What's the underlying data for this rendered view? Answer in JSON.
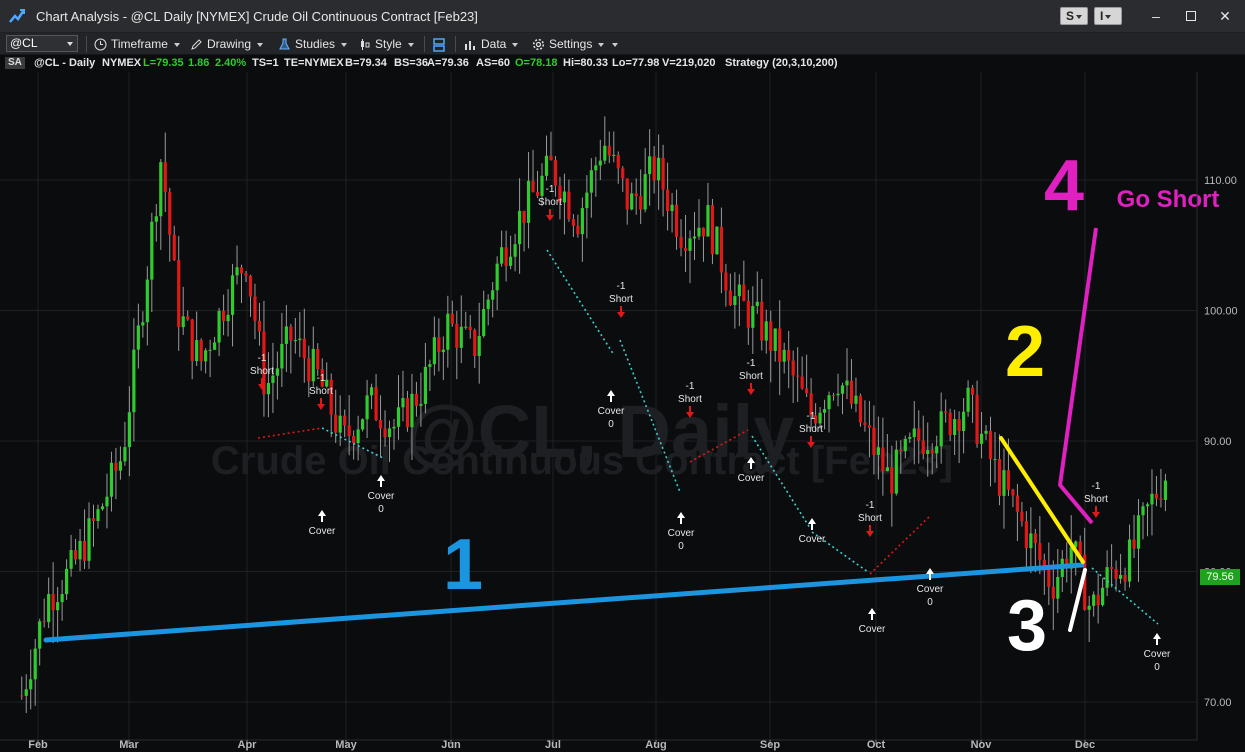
{
  "window": {
    "title": "Chart Analysis - @CL Daily [NYMEX] Crude Oil Continuous Contract [Feb23]",
    "btn_s": "S",
    "btn_i": "I"
  },
  "toolbar": {
    "symbol": "@CL",
    "timeframe": "Timeframe",
    "drawing": "Drawing",
    "studies": "Studies",
    "style": "Style",
    "data": "Data",
    "settings": "Settings"
  },
  "status": {
    "badge": "SA",
    "symbol": "@CL - Daily",
    "exchange": "NYMEX",
    "last": "L=79.35",
    "change": "1.86",
    "change_pct": "2.40%",
    "ts": "TS=1",
    "te": "TE=NYMEX",
    "bid": "B=79.34",
    "bid_size": "BS=36",
    "ask": "A=79.36",
    "ask_size": "AS=60",
    "open": "O=78.18",
    "high": "Hi=80.33",
    "low": "Lo=77.98",
    "volume": "V=219,020",
    "strategy": "Strategy (20,3,10,200)"
  },
  "colors": {
    "up": "#2ecc2e",
    "down": "#e01818",
    "line1": "#1c95e0",
    "line2": "#ffee00",
    "line3": "#ffffff",
    "line4": "#e020c0",
    "grid": "#1f2124",
    "trade": "#3ad0d0"
  },
  "watermark": {
    "line1": "@CL, Daily",
    "line2": "Crude Oil Continuous Contract [Feb23]"
  },
  "price_tag": "79.56",
  "chart_data": {
    "type": "candlestick",
    "x_labels": [
      "Feb",
      "Mar",
      "Apr",
      "May",
      "Jun",
      "Jul",
      "Aug",
      "Sep",
      "Oct",
      "Nov",
      "Dec"
    ],
    "y_ticks": [
      "110.00",
      "100.00",
      "90.00",
      "80.00",
      "70.00"
    ],
    "ylim": [
      69,
      114
    ],
    "last_price": 79.56,
    "trendlines": [
      {
        "label": "1",
        "from": [
          "Feb",
          74.8
        ],
        "to": [
          "Dec",
          80.6
        ]
      },
      {
        "label": "2",
        "from": [
          "Nov",
          92.0
        ],
        "to": [
          "Dec",
          80.6
        ]
      },
      {
        "label": "3",
        "from": [
          "Nov",
          76.0
        ],
        "to": [
          "Dec",
          80.6
        ]
      },
      {
        "label": "4",
        "from": [
          "Nov",
          86.5
        ],
        "to": [
          "Dec",
          106.0
        ]
      }
    ],
    "annotations": [
      {
        "text": "1",
        "color": "#1c95e0"
      },
      {
        "text": "2",
        "color": "#ffee00"
      },
      {
        "text": "3",
        "color": "#ffffff"
      },
      {
        "text": "4",
        "color": "#e020c0"
      },
      {
        "text": "Go Short",
        "color": "#e020c0"
      }
    ],
    "signals": [
      {
        "kind": "short",
        "label": "Short",
        "qty": "-1",
        "month": "Apr",
        "price": 94.0
      },
      {
        "kind": "short",
        "label": "Short",
        "qty": "-1",
        "month": "Apr",
        "price": 92.0
      },
      {
        "kind": "cover",
        "label": "Cover",
        "qty": "",
        "month": "Apr",
        "price": 85.5
      },
      {
        "kind": "cover",
        "label": "Cover",
        "qty": "0",
        "month": "May",
        "price": 88.3
      },
      {
        "kind": "short",
        "label": "Short",
        "qty": "-1",
        "month": "Jul",
        "price": 105.0
      },
      {
        "kind": "short",
        "label": "Short",
        "qty": "-1",
        "month": "Jul",
        "price": 97.5
      },
      {
        "kind": "cover",
        "label": "Cover",
        "qty": "0",
        "month": "Jul",
        "price": 93.5
      },
      {
        "kind": "short",
        "label": "Short",
        "qty": "-1",
        "month": "Aug",
        "price": 91.5
      },
      {
        "kind": "cover",
        "label": "Cover",
        "qty": "0",
        "month": "Aug",
        "price": 85.8
      },
      {
        "kind": "short",
        "label": "Short",
        "qty": "-1",
        "month": "Aug",
        "price": 94.3
      },
      {
        "kind": "cover",
        "label": "Cover",
        "qty": "",
        "month": "Aug",
        "price": 88.8
      },
      {
        "kind": "short",
        "label": "Short",
        "qty": "-1",
        "month": "Sep",
        "price": 88.4
      },
      {
        "kind": "cover",
        "label": "Cover",
        "qty": "",
        "month": "Sep",
        "price": 84.0
      },
      {
        "kind": "short",
        "label": "Short",
        "qty": "-1",
        "month": "Sep",
        "price": 81.8
      },
      {
        "kind": "cover",
        "label": "Cover",
        "qty": "",
        "month": "Oct",
        "price": 76.5
      },
      {
        "kind": "cover",
        "label": "Cover",
        "qty": "0",
        "month": "Oct",
        "price": 79.5
      },
      {
        "kind": "short",
        "label": "Short",
        "qty": "-1",
        "month": "Dec",
        "price": 83.3
      },
      {
        "kind": "cover",
        "label": "Cover",
        "qty": "0",
        "month": "Dec",
        "price": 75.5
      }
    ]
  }
}
